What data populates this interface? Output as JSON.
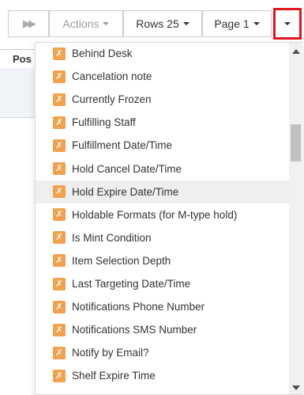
{
  "toolbar": {
    "fast_forward": "⏩",
    "actions_label": "Actions",
    "rows_label": "Rows 25",
    "page_label": "Page 1"
  },
  "grid": {
    "first_header": "Pos"
  },
  "menu": {
    "items": [
      {
        "label": "Behind Desk",
        "icon": "x-box-icon"
      },
      {
        "label": "Cancelation note",
        "icon": "x-box-icon"
      },
      {
        "label": "Currently Frozen",
        "icon": "x-box-icon"
      },
      {
        "label": "Fulfilling Staff",
        "icon": "x-box-icon"
      },
      {
        "label": "Fulfillment Date/Time",
        "icon": "x-box-icon"
      },
      {
        "label": "Hold Cancel Date/Time",
        "icon": "x-box-icon"
      },
      {
        "label": "Hold Expire Date/Time",
        "icon": "x-box-icon"
      },
      {
        "label": "Holdable Formats (for M-type hold)",
        "icon": "x-box-icon"
      },
      {
        "label": "Is Mint Condition",
        "icon": "x-box-icon"
      },
      {
        "label": "Item Selection Depth",
        "icon": "x-box-icon"
      },
      {
        "label": "Last Targeting Date/Time",
        "icon": "x-box-icon"
      },
      {
        "label": "Notifications Phone Number",
        "icon": "x-box-icon"
      },
      {
        "label": "Notifications SMS Number",
        "icon": "x-box-icon"
      },
      {
        "label": "Notify by Email?",
        "icon": "x-box-icon"
      },
      {
        "label": "Shelf Expire Time",
        "icon": "x-box-icon"
      }
    ],
    "x_glyph": "✗",
    "hovered_item": "Hold Expire Date/Time"
  },
  "colors": {
    "highlight_border": "#e0161d",
    "x_box": "#f0a24e",
    "hover_bg": "#efefef"
  }
}
